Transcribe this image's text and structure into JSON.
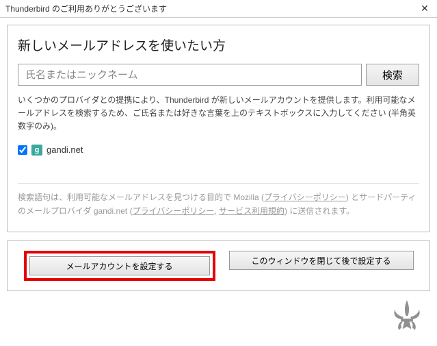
{
  "titlebar": {
    "text": "Thunderbird のご利用ありがとうございます",
    "close": "✕"
  },
  "panel": {
    "heading": "新しいメールアドレスを使いたい方",
    "search_placeholder": "氏名またはニックネーム",
    "search_button": "検索",
    "description": "いくつかのプロバイダとの提携により、Thunderbird が新しいメールアカウントを提供します。利用可能なメールアドレスを検索するため、ご氏名または好きな言葉を上のテキストボックスに入力してください (半角英数字のみ)。",
    "provider": {
      "checked": true,
      "icon_letter": "g",
      "name": "gandi.net"
    },
    "footer": {
      "t1": "検索語句は、利用可能なメールアドレスを見つける目的で Mozilla (",
      "link1": "プライバシーポリシー",
      "t2": ") とサードパーティのメールプロバイダ gandi.net (",
      "link2": "プライバシーポリシー",
      "t3": ", ",
      "link3": "サービス利用規約",
      "t4": ") に送信されます。"
    }
  },
  "buttons": {
    "setup": "メールアカウントを設定する",
    "close_later": "このウィンドウを閉じて後で設定する"
  }
}
